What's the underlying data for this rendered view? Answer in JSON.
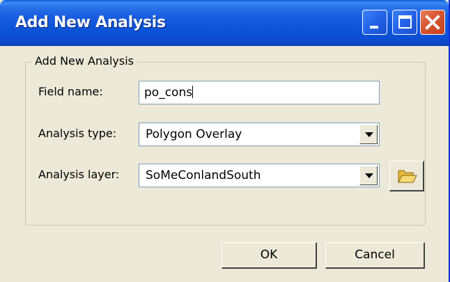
{
  "window": {
    "title": "Add New Analysis",
    "controls": [
      "minimize-icon",
      "maximize-icon",
      "close-icon"
    ]
  },
  "group": {
    "legend": "Add New Analysis"
  },
  "fields": {
    "field_name": {
      "label": "Field name:",
      "value": "po_cons"
    },
    "analysis_type": {
      "label": "Analysis type:",
      "selected": "Polygon Overlay"
    },
    "analysis_layer": {
      "label": "Analysis layer:",
      "selected": "SoMeConlandSouth",
      "browse_icon": "folder-open-icon"
    }
  },
  "buttons": {
    "ok": "OK",
    "cancel": "Cancel"
  },
  "colors": {
    "titlebar": "#0b4fd4",
    "close_button": "#d7552f",
    "dialog_bg": "#ece9d8"
  }
}
